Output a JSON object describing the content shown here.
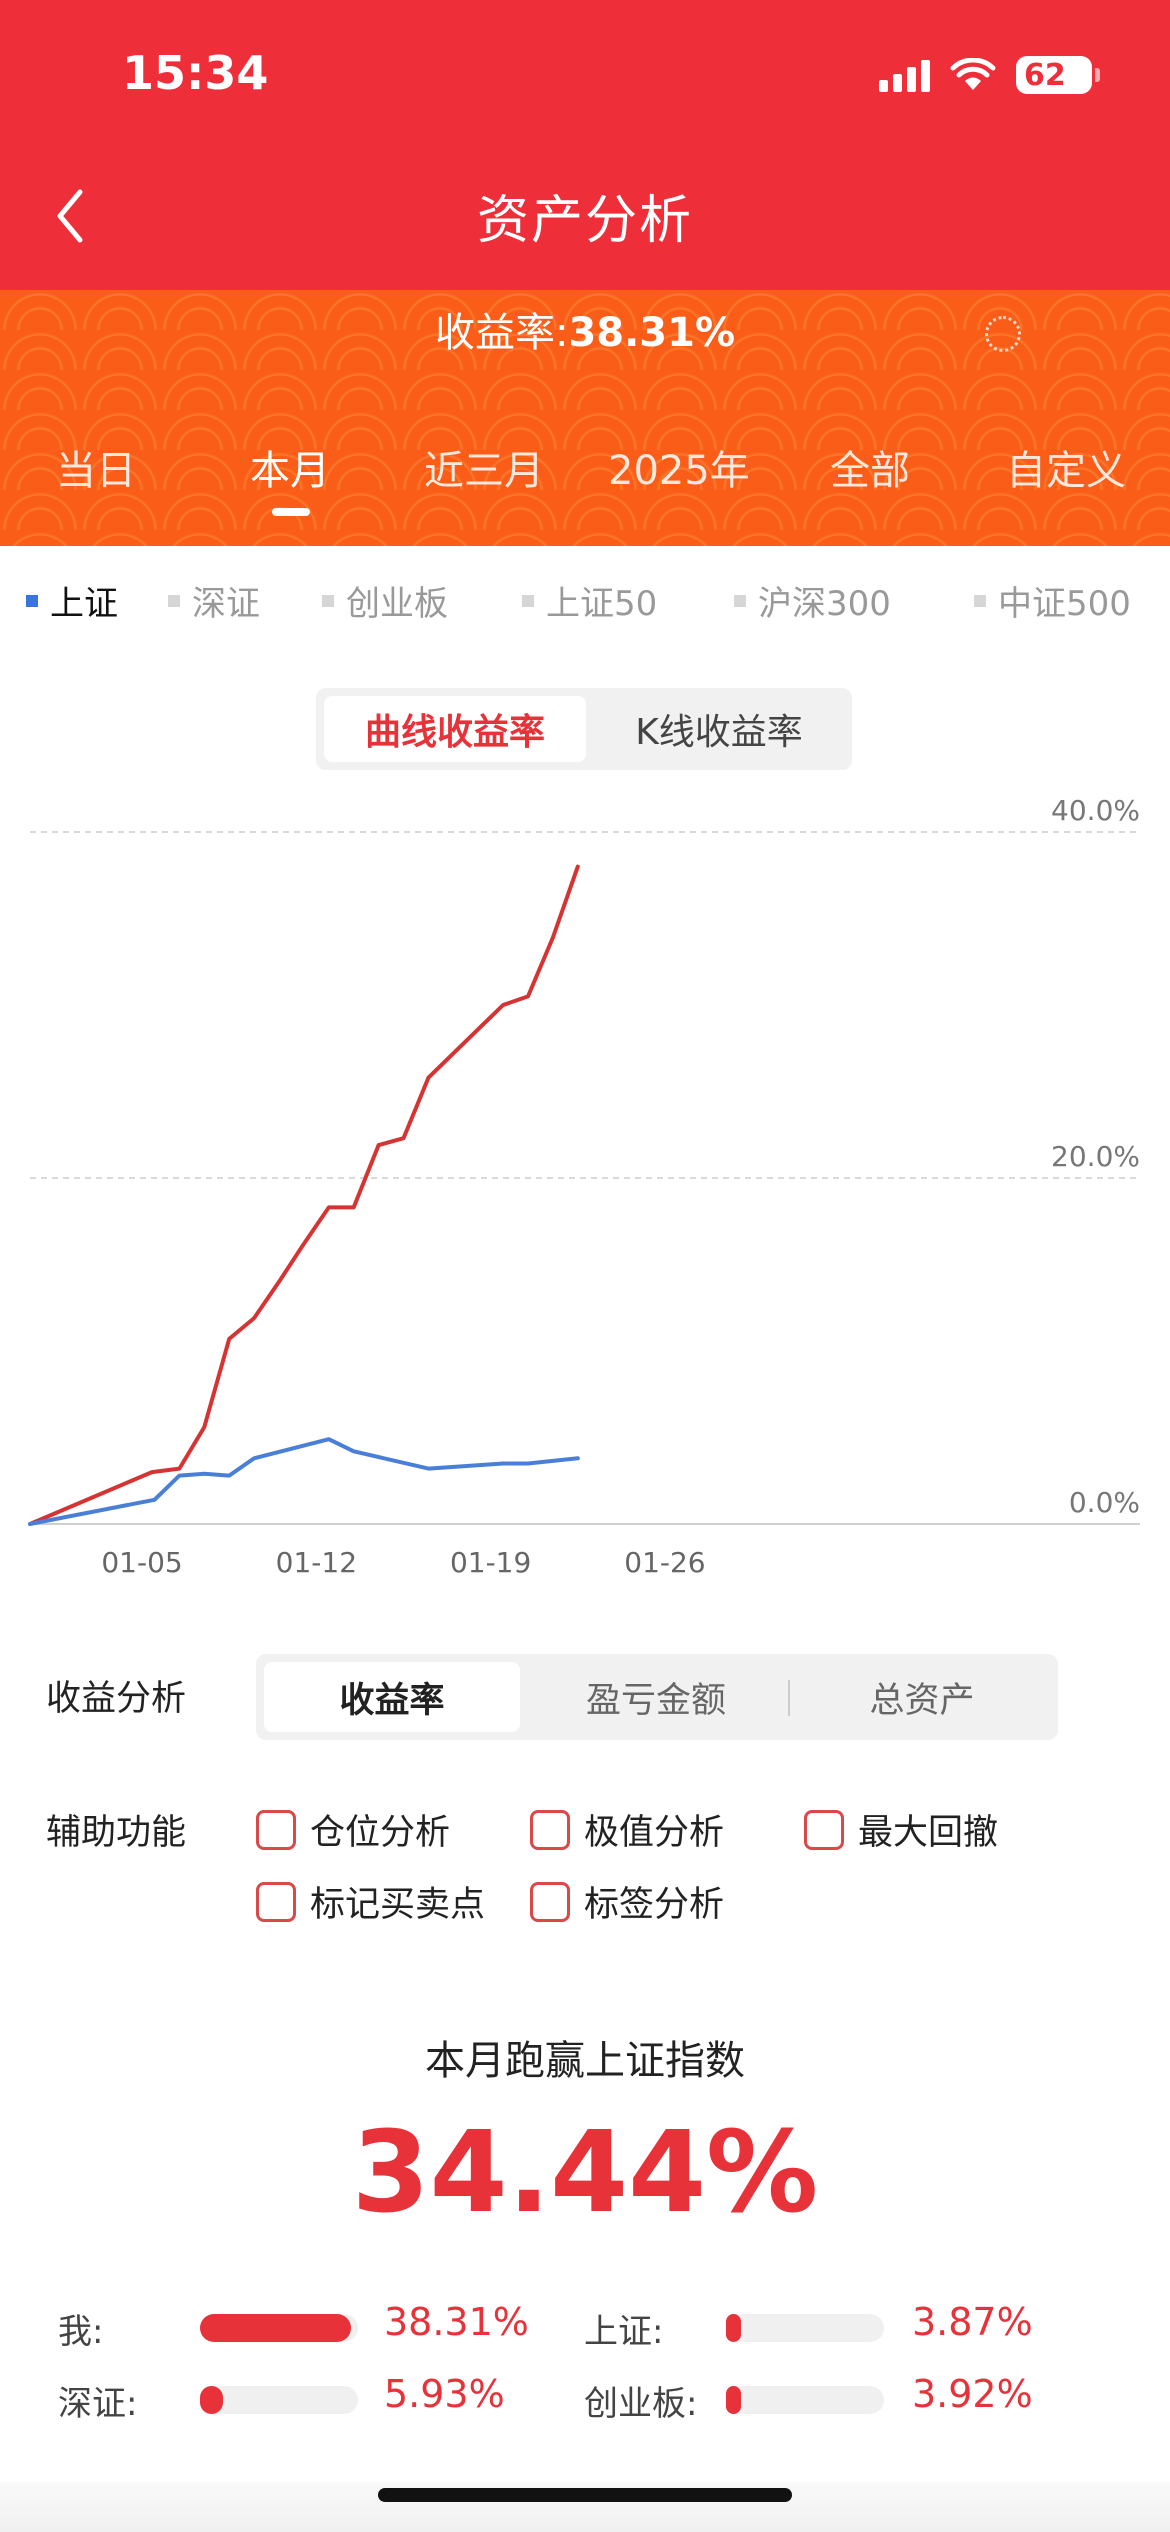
{
  "status_bar": {
    "time": "15:34",
    "battery": "62"
  },
  "header": {
    "title": "资产分析"
  },
  "summary": {
    "label": "收益率:",
    "value": "38.31%"
  },
  "period_tabs": [
    {
      "label": "当日"
    },
    {
      "label": "本月",
      "active": true
    },
    {
      "label": "近三月"
    },
    {
      "label": "2025年"
    },
    {
      "label": "全部"
    },
    {
      "label": "自定义"
    }
  ],
  "index_filters": [
    {
      "label": "上证",
      "active": true
    },
    {
      "label": "深证"
    },
    {
      "label": "创业板"
    },
    {
      "label": "上证50"
    },
    {
      "label": "沪深300"
    },
    {
      "label": "中证500"
    }
  ],
  "chart_mode": {
    "active": "曲线收益率",
    "inactive": "K线收益率"
  },
  "chart_data": {
    "type": "line",
    "x_tick_labels": [
      "01-05",
      "01-12",
      "01-19",
      "01-26"
    ],
    "y_tick_labels": [
      "40.0%",
      "20.0%",
      "0.0%"
    ],
    "ylim": [
      0,
      40
    ],
    "grid": true,
    "colors": {
      "mine": "#d63333",
      "index": "#4a7fd8"
    },
    "series": [
      {
        "key": "mine",
        "x": [
          0.0,
          4.9,
          6.0,
          7.0,
          8.0,
          9.0,
          10.0,
          11.0,
          12.0,
          13.0,
          14.0,
          15.0,
          16.0,
          17.0,
          18.0,
          19.0,
          20.0,
          21.0,
          22.0
        ],
        "y": [
          0.0,
          3.0,
          3.2,
          5.6,
          10.7,
          11.9,
          14.0,
          16.2,
          18.3,
          18.3,
          21.9,
          22.3,
          25.8,
          27.2,
          28.6,
          30.0,
          30.5,
          33.9,
          38.0
        ]
      },
      {
        "key": "index",
        "x": [
          0.0,
          5.0,
          6.0,
          7.0,
          8.0,
          9.0,
          12.0,
          13.0,
          16.0,
          19.0,
          20.0,
          22.0
        ],
        "y": [
          0.0,
          1.4,
          2.8,
          2.9,
          2.8,
          3.8,
          4.9,
          4.2,
          3.2,
          3.5,
          3.5,
          3.8
        ]
      }
    ]
  },
  "analysis": {
    "label": "收益分析",
    "options": [
      "收益率",
      "盈亏金额",
      "总资产"
    ],
    "selected": "收益率"
  },
  "aux": {
    "label": "辅助功能",
    "options": [
      "仓位分析",
      "极值分析",
      "最大回撤",
      "标记买卖点",
      "标签分析"
    ]
  },
  "beat": {
    "title": "本月跑赢上证指数",
    "value": "34.44%"
  },
  "comparison": [
    {
      "label": "我:",
      "value": "38.31%",
      "pct": 38.31
    },
    {
      "label": "上证:",
      "value": "3.87%",
      "pct": 3.87
    },
    {
      "label": "深证:",
      "value": "5.93%",
      "pct": 5.93
    },
    {
      "label": "创业板:",
      "value": "3.92%",
      "pct": 3.92
    }
  ]
}
